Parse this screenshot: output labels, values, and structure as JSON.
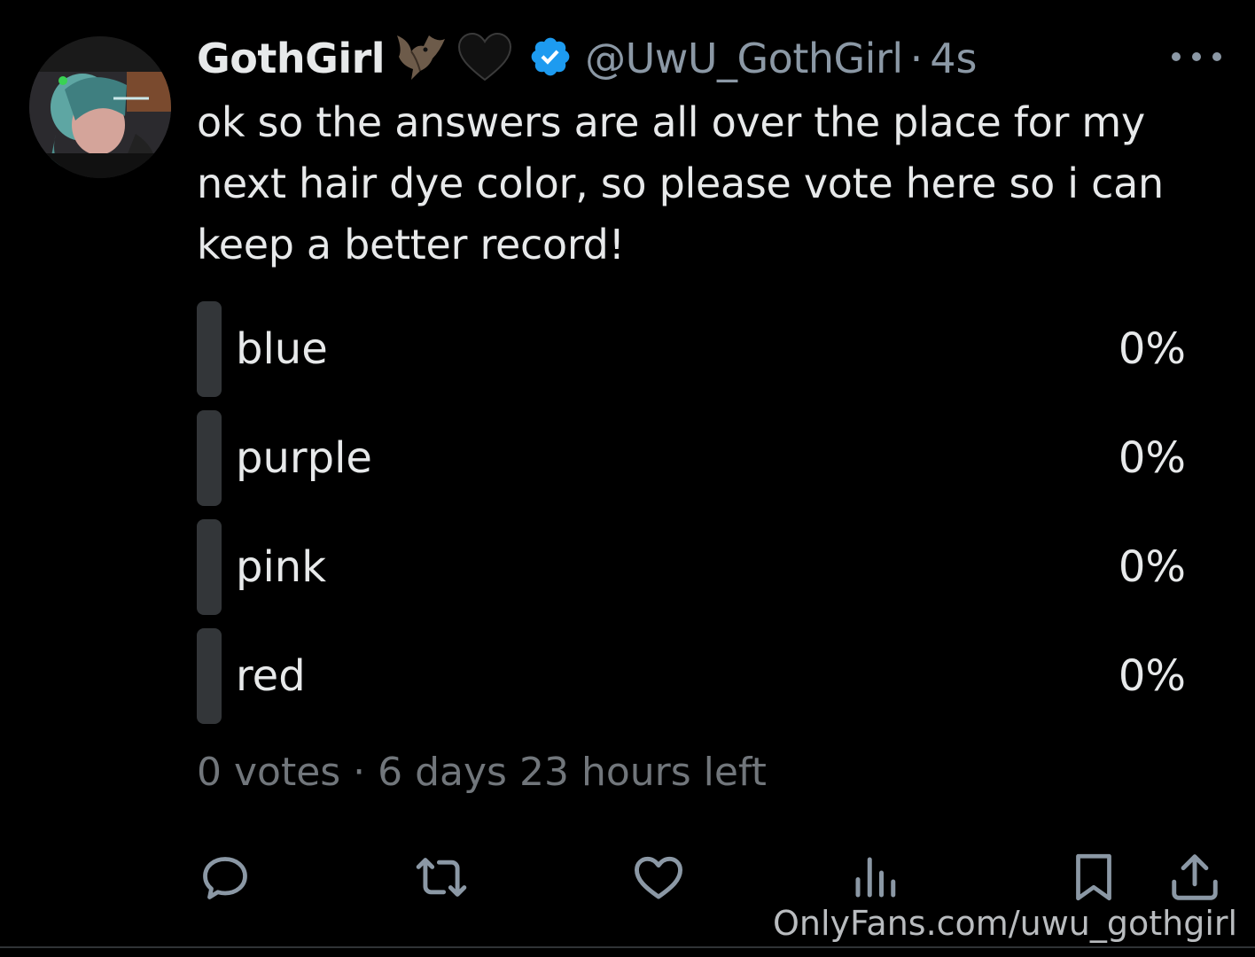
{
  "user": {
    "display_name": "GothGirl",
    "name_emojis": [
      "bat-emoji",
      "black-heart-emoji"
    ],
    "verified": true,
    "handle": "@UwU_GothGirl",
    "separator": "·",
    "time": "4s"
  },
  "tweet": {
    "text": "ok so the answers are all over the place for my next hair dye color, so please vote here so i can keep a better record!"
  },
  "poll": {
    "options": [
      {
        "label": "blue",
        "percent_text": "0%",
        "percent": 0
      },
      {
        "label": "purple",
        "percent_text": "0%",
        "percent": 0
      },
      {
        "label": "pink",
        "percent_text": "0%",
        "percent": 0
      },
      {
        "label": "red",
        "percent_text": "0%",
        "percent": 0
      }
    ],
    "meta": "0 votes · 6 days 23 hours left"
  },
  "actions": [
    "reply-icon",
    "retweet-icon",
    "like-icon",
    "views-icon",
    "bookmark-icon",
    "share-icon"
  ],
  "watermark": "OnlyFans.com/uwu_gothgirl",
  "colors": {
    "background": "#000000",
    "text": "#e7e9ea",
    "secondary": "#71767b",
    "verified": "#1d9bf0",
    "poll_bar": "#333639"
  }
}
